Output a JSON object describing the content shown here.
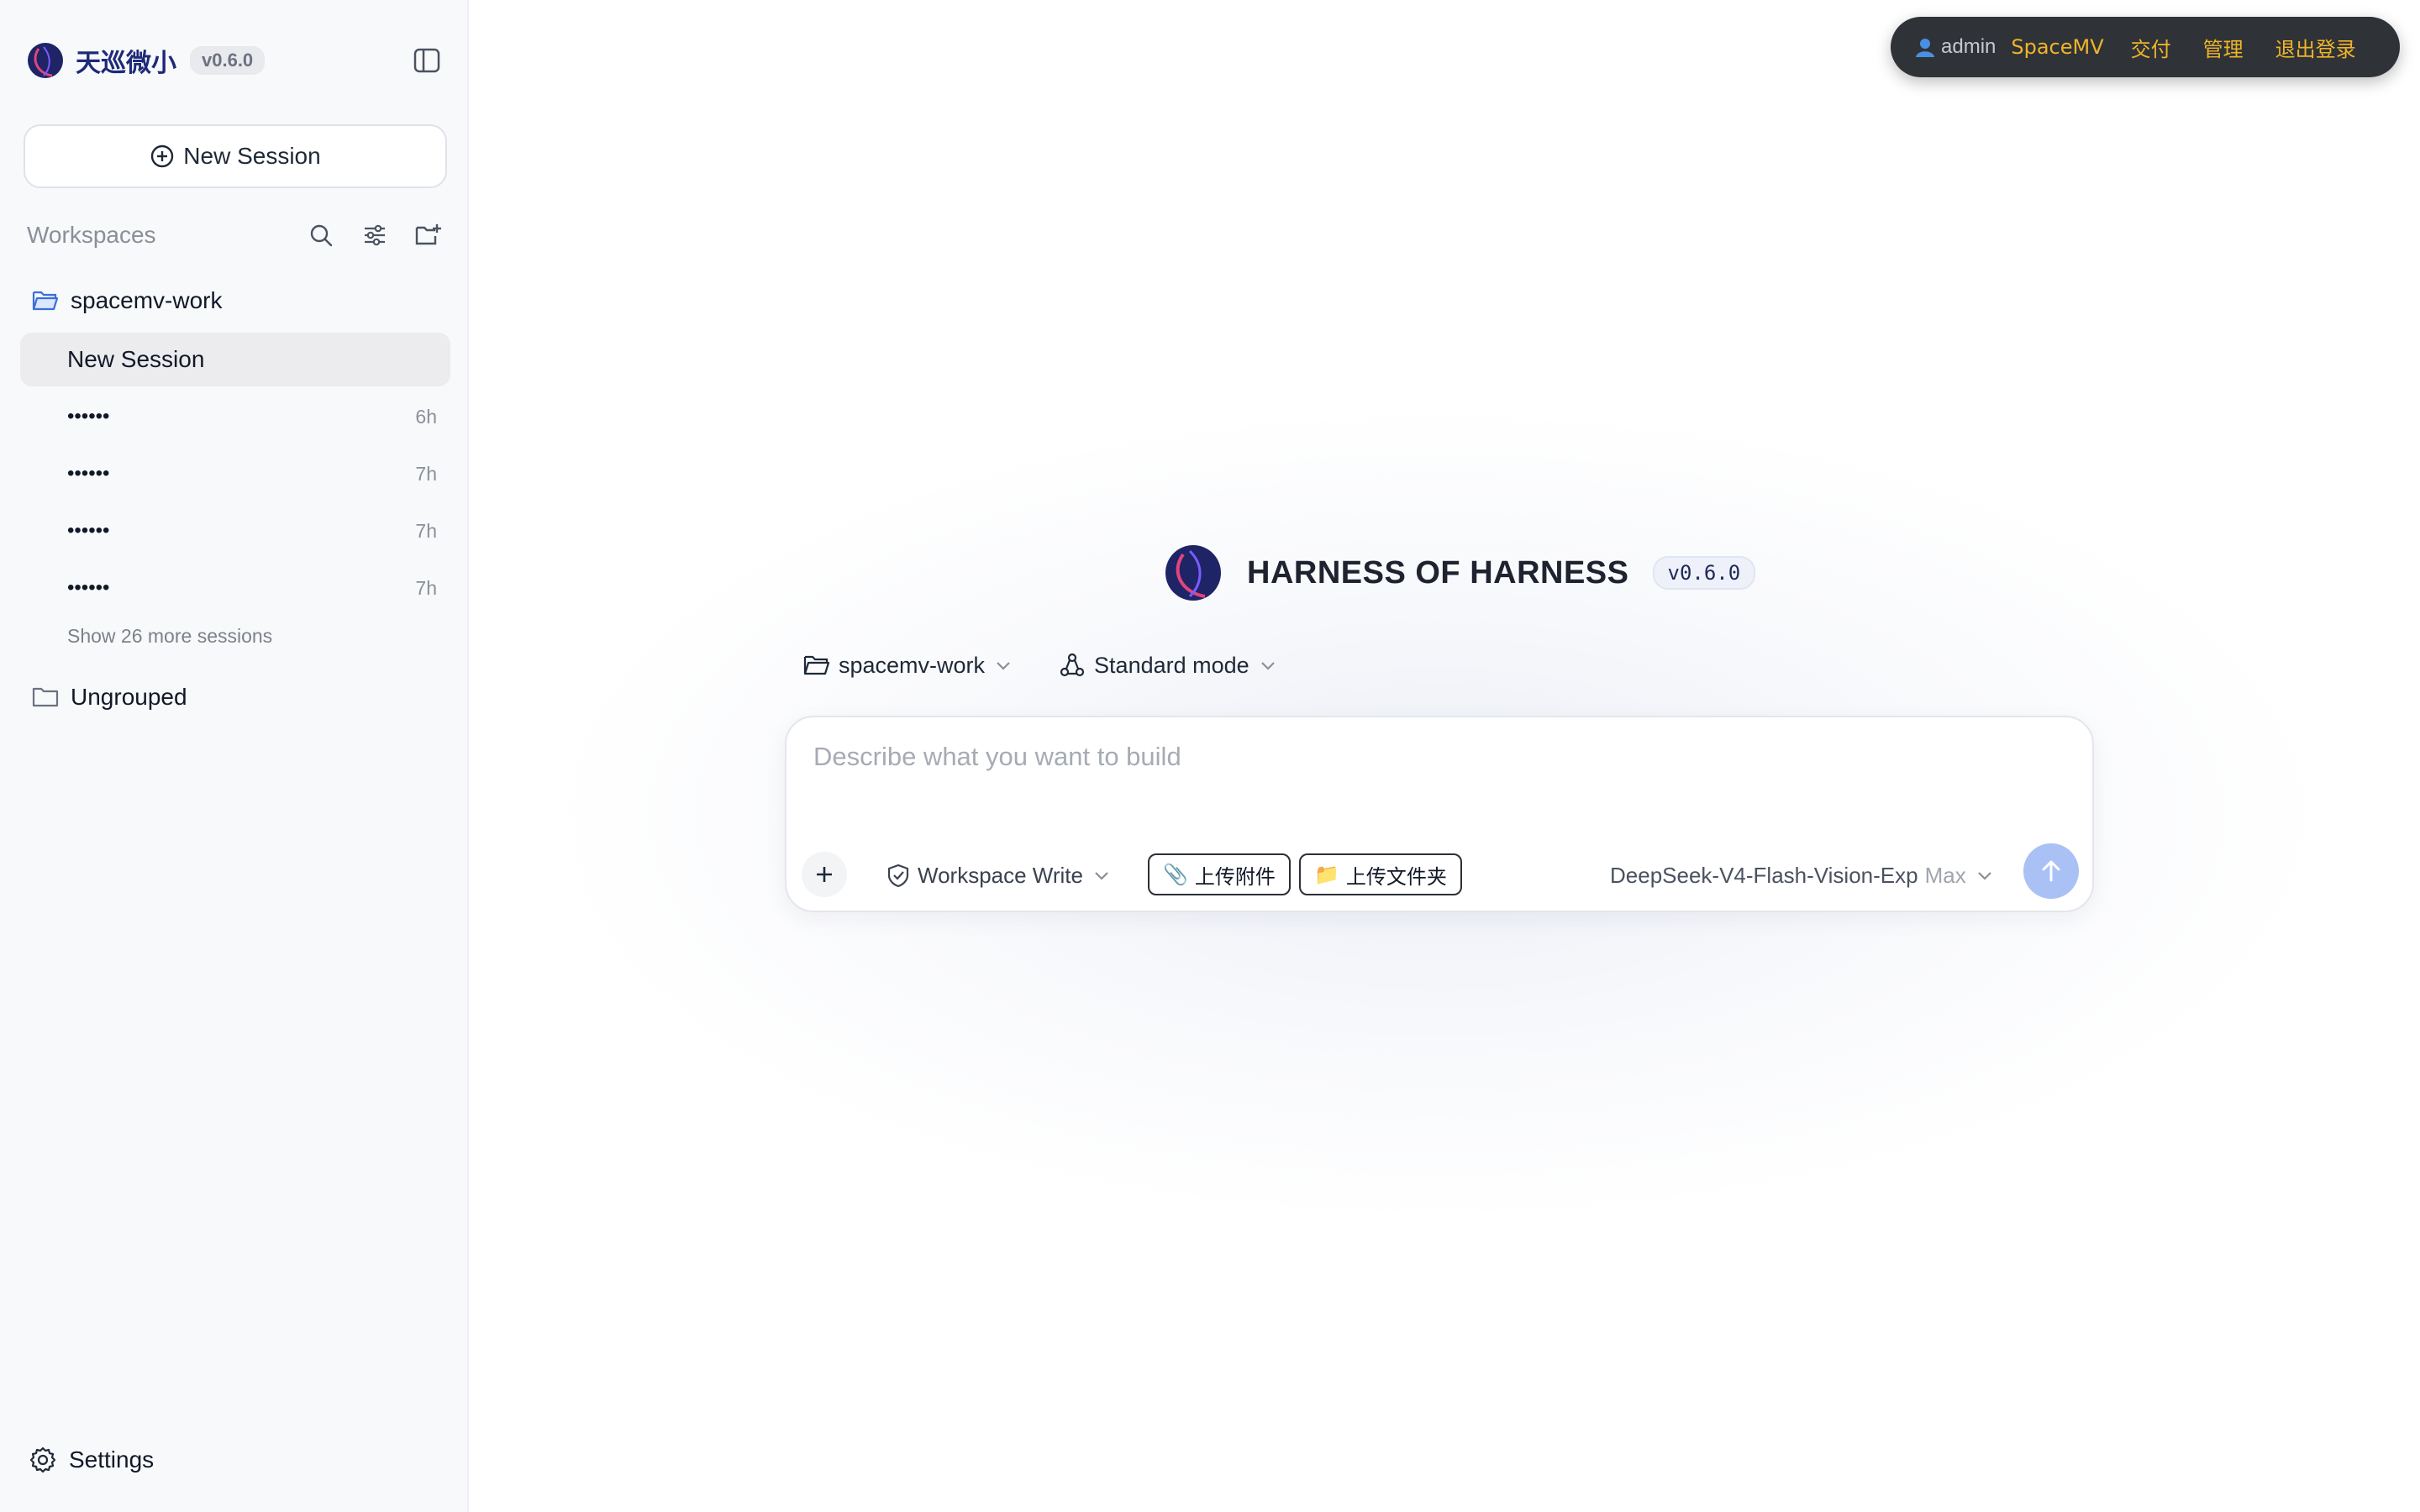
{
  "sidebar": {
    "brand_name": "天巡微小",
    "version": "v0.6.0",
    "new_session_label": "New Session",
    "workspaces_title": "Workspaces",
    "folders": [
      {
        "name": "spacemv-work",
        "active_session": "New Session",
        "sessions": [
          {
            "title": "••••••",
            "time": "6h"
          },
          {
            "title": "••••••",
            "time": "7h"
          },
          {
            "title": "••••••",
            "time": "7h"
          },
          {
            "title": "••••••",
            "time": "7h"
          }
        ],
        "show_more": "Show 26 more sessions"
      },
      {
        "name": "Ungrouped"
      }
    ],
    "settings_label": "Settings"
  },
  "userbar": {
    "username": "admin",
    "brand_link": "SpaceMV",
    "links": [
      "交付",
      "管理",
      "退出登录"
    ]
  },
  "hero": {
    "title": "HARNESS OF HARNESS",
    "version": "v0.6.0"
  },
  "selectors": {
    "workspace": "spacemv-work",
    "mode": "Standard mode"
  },
  "composer": {
    "placeholder": "Describe what you want to build",
    "permission": "Workspace Write",
    "upload_attachment": "上传附件",
    "upload_folder": "上传文件夹",
    "model": "DeepSeek-V4-Flash-Vision-Exp",
    "effort": "Max"
  },
  "colors": {
    "brand_navy": "#1e2a78",
    "accent_link": "#f0b429",
    "send_button": "#a9c1f5",
    "userbar_bg": "#2f3338"
  },
  "icons": [
    "logo-icon",
    "sidebar-toggle-icon",
    "plus-circle-icon",
    "search-icon",
    "filter-icon",
    "new-folder-icon",
    "folder-open-icon",
    "folder-icon",
    "gear-icon",
    "user-icon",
    "mode-icon",
    "shield-icon",
    "chevron-down-icon",
    "plus-icon",
    "paperclip-icon",
    "folder-emoji-icon",
    "arrow-up-icon"
  ]
}
